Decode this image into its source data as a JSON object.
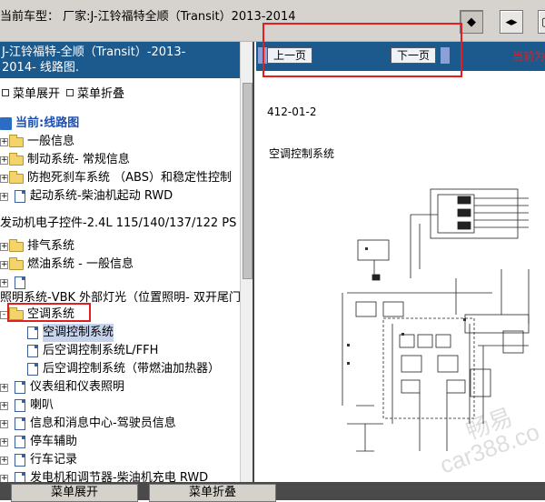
{
  "toolbar": {
    "car_model": "当前车型： 厂家:J-江铃福特全顺（Transit）2013-2014",
    "button_icons": [
      "dot-in-frame-icon",
      "expand-horizontal-icon",
      "window-icon"
    ]
  },
  "left_panel": {
    "title_line1": "J-江铃福特-全顺（Transit）-2013-",
    "title_line2": "2014- 线路图.",
    "expand_all": "菜单展开",
    "collapse_all": "菜单折叠",
    "tree": [
      {
        "label": "当前:线路图",
        "icon": "book",
        "level": 0
      },
      {
        "label": "一般信息",
        "icon": "folder",
        "level": 1,
        "toggle": "+"
      },
      {
        "label": "制动系统- 常规信息",
        "icon": "folder",
        "level": 1,
        "toggle": "+"
      },
      {
        "label": "防抱死刹车系统 （ABS）和稳定性控制",
        "icon": "folder",
        "level": 1,
        "toggle": "+"
      },
      {
        "label": "起动系统-柴油机起动 RWD",
        "icon": "doc",
        "level": 1,
        "toggle": "+"
      },
      {
        "label": "发动机电子控件-2.4L 115/140/137/122 PS",
        "icon": "none",
        "level": 0
      },
      {
        "label": "排气系统",
        "icon": "folder",
        "level": 1,
        "toggle": "+"
      },
      {
        "label": "燃油系统 - 一般信息",
        "icon": "folder",
        "level": 1,
        "toggle": "+"
      },
      {
        "label": "",
        "icon": "doc",
        "level": 1
      },
      {
        "label": "照明系统-VBK 外部灯光（位置照明- 双开尾门",
        "icon": "none",
        "level": 0
      },
      {
        "label": "空调系统",
        "icon": "folder",
        "level": 1,
        "toggle": "-"
      },
      {
        "label": "空调控制系统",
        "icon": "doc",
        "level": 2,
        "selected": true
      },
      {
        "label": "后空调控制系统L/FFH",
        "icon": "doc",
        "level": 2
      },
      {
        "label": "后空调控制系统（带燃油加热器）",
        "icon": "doc",
        "level": 2
      },
      {
        "label": "仪表组和仪表照明",
        "icon": "doc",
        "level": 1
      },
      {
        "label": "喇叭",
        "icon": "doc",
        "level": 1
      },
      {
        "label": "信息和消息中心-驾驶员信息",
        "icon": "doc",
        "level": 1
      },
      {
        "label": "停车辅助",
        "icon": "doc",
        "level": 1
      },
      {
        "label": "行车记录",
        "icon": "doc",
        "level": 1
      },
      {
        "label": "发电机和调节器-柴油机充电 RWD",
        "icon": "doc",
        "level": 1
      }
    ]
  },
  "bottom": {
    "expand_button": "菜单展开",
    "collapse_button": "菜单折叠"
  },
  "diagram_panel": {
    "prev_page": "上一页",
    "next_page": "下一页",
    "current_as": "当前为",
    "page_code": "412-01-2",
    "section_title": "空调控制系统",
    "watermark1": "畅易",
    "watermark2": "car388.co"
  },
  "colors": {
    "panel_header": "#1c5a8e",
    "highlight_box": "#e02020",
    "selection": "#c7d3ea"
  }
}
